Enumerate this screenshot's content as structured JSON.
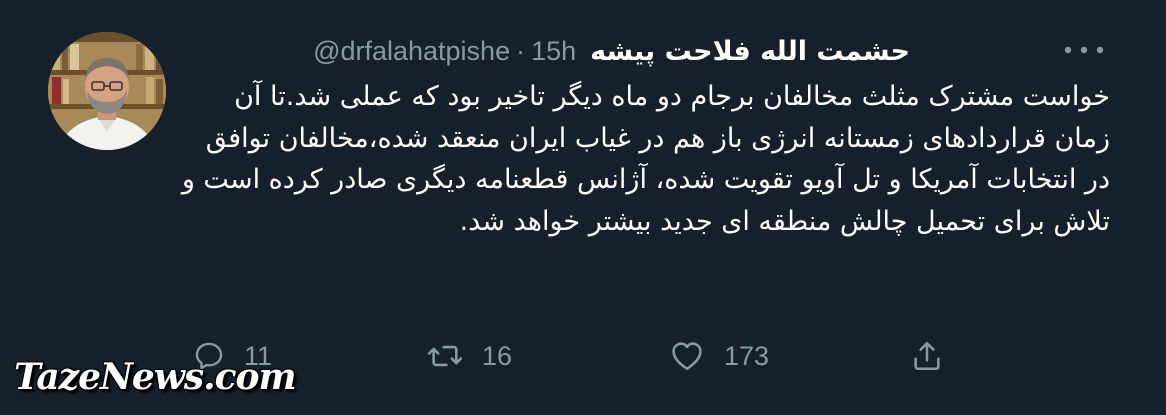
{
  "tweet": {
    "author": {
      "display_name": "حشمت الله فلاحت پیشه",
      "handle": "@drfalahatpishe",
      "time": "15h"
    },
    "body": "خواست مشترک مثلث مخالفان برجام دو ماه دیگر تاخیر بود که عملی شد.تا آن زمان قراردادهای زمستانه انرژی باز هم در غیاب ایران منعقد شده،مخالفان توافق در انتخابات آمریکا و تل آویو تقویت شده، آژانس قطعنامه دیگری صادر کرده است و تلاش برای تحمیل چالش منطقه ای جدید بیشتر خواهد شد.",
    "actions": {
      "reply": {
        "icon": "reply-icon",
        "count": "11"
      },
      "retweet": {
        "icon": "retweet-icon",
        "count": "16"
      },
      "like": {
        "icon": "heart-icon",
        "count": "173"
      },
      "share": {
        "icon": "share-icon"
      }
    }
  },
  "watermark": "TazeNews.com",
  "colors": {
    "background": "#15202b",
    "text_primary": "#ffffff",
    "text_secondary": "#8899a6"
  }
}
